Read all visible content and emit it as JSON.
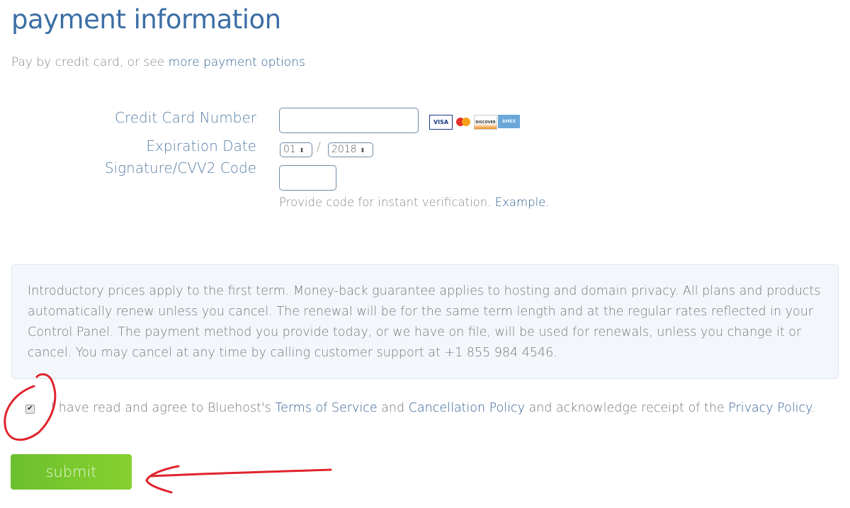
{
  "title": "payment information",
  "intro": {
    "text": "Pay by credit card, or see ",
    "link": "more payment options"
  },
  "form": {
    "cc_label": "Credit Card Number",
    "cc_value": "",
    "exp_label": "Expiration Date",
    "exp_month": "01",
    "exp_sep": "/",
    "exp_year": "2018",
    "cvv_label": "Signature/CVV2 Code",
    "cvv_value": "",
    "cvv_help": "Provide code for instant verification. ",
    "cvv_example": "Example."
  },
  "cards": [
    "VISA",
    "MC",
    "DISCOVER",
    "AMEX"
  ],
  "notice": "Introductory prices apply to the first term. Money-back guarantee applies to hosting and domain privacy. All plans and products automatically renew unless you cancel. The renewal will be for the same term length and at the regular rates reflected in your Control Panel. The payment method you provide today, or we have on file, will be used for renewals, unless you change it or cancel. You may cancel at any time by calling customer support at +1 855 984 4546.",
  "agree": {
    "checked": true,
    "t1": "I have read and agree to Bluehost's ",
    "tos": "Terms of Service",
    "t2": " and ",
    "cancel": "Cancellation Policy",
    "t3": " and acknowledge receipt of the ",
    "privacy": "Privacy Policy",
    "t4": "."
  },
  "submit_label": "submit",
  "colors": {
    "accent": "#3b6ea5",
    "submit": "#77c62f",
    "annotation": "#e0242c"
  }
}
